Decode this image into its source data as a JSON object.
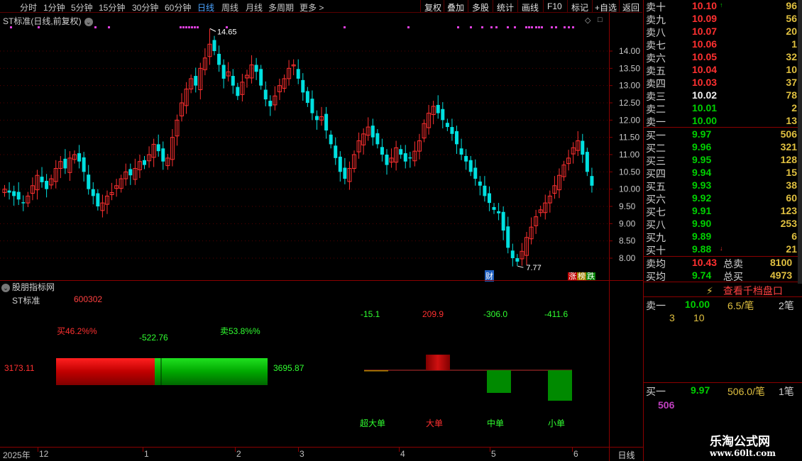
{
  "toolbar": {
    "periods": [
      "分时",
      "1分钟",
      "5分钟",
      "15分钟",
      "30分钟",
      "60分钟",
      "日线",
      "周线",
      "月线",
      "多周期",
      "更多"
    ],
    "active_period": "日线",
    "more_arrow": ">",
    "actions": [
      "复权",
      "叠加",
      "多股",
      "统计",
      "画线",
      "F10",
      "标记",
      "+自选",
      "返回"
    ]
  },
  "chart": {
    "title": "ST标准(日线,前复权)",
    "high_label": "14.65",
    "low_label": "7.77",
    "y_ticks": [
      "14.00",
      "13.50",
      "13.00",
      "12.50",
      "12.00",
      "11.50",
      "11.00",
      "10.50",
      "10.00",
      "9.50",
      "9.00",
      "8.50",
      "8.00"
    ],
    "badge_cai": "财",
    "badge_zhang": "涨",
    "badge_ta": "榜",
    "badge_die": "跌"
  },
  "chart_data": {
    "type": "candlestick",
    "title": "ST标准(日线,前复权)",
    "ylim": [
      7.7,
      14.9
    ],
    "y_ticks": [
      8.0,
      8.5,
      9.0,
      9.5,
      10.0,
      10.5,
      11.0,
      11.5,
      12.0,
      12.5,
      13.0,
      13.5,
      14.0
    ],
    "high": 14.65,
    "low": 7.77,
    "x_ticks": [
      "2025年",
      "12",
      "1",
      "2",
      "3",
      "4",
      "5",
      "6"
    ],
    "closes": [
      10.0,
      9.9,
      9.8,
      9.7,
      9.6,
      9.8,
      10.1,
      10.4,
      10.2,
      10.0,
      10.3,
      10.6,
      10.8,
      10.6,
      10.9,
      11.0,
      10.8,
      10.5,
      10.0,
      9.8,
      9.5,
      9.6,
      9.8,
      9.9,
      10.1,
      10.3,
      10.5,
      10.4,
      10.6,
      10.8,
      10.7,
      11.0,
      11.3,
      11.1,
      10.8,
      10.9,
      11.5,
      12.0,
      12.5,
      12.9,
      13.2,
      13.0,
      13.5,
      13.8,
      14.2,
      14.0,
      13.6,
      13.2,
      13.4,
      13.0,
      12.7,
      13.1,
      13.3,
      13.6,
      13.4,
      13.0,
      12.6,
      12.4,
      12.7,
      13.0,
      13.2,
      13.5,
      13.6,
      13.2,
      12.8,
      12.5,
      12.2,
      12.0,
      12.1,
      11.7,
      11.3,
      10.9,
      10.5,
      10.3,
      10.6,
      11.0,
      11.4,
      11.6,
      11.8,
      11.5,
      11.3,
      11.0,
      10.7,
      10.9,
      11.2,
      11.0,
      10.8,
      10.9,
      11.1,
      11.4,
      11.9,
      12.2,
      12.4,
      12.2,
      12.0,
      11.8,
      11.6,
      11.3,
      11.0,
      10.8,
      10.5,
      10.3,
      10.1,
      9.8,
      9.6,
      9.4,
      9.3,
      8.8,
      8.3,
      8.0,
      7.9,
      8.2,
      8.6,
      8.9,
      9.2,
      9.4,
      9.6,
      9.8,
      10.1,
      10.4,
      10.7,
      10.9,
      11.2,
      11.4,
      11.0,
      10.5,
      10.1
    ]
  },
  "indicator": {
    "title": "股朋指标网",
    "stock_name": "ST标准",
    "stock_code": "600302",
    "buy_pct": "买46.2%%",
    "sell_pct": "卖53.8%%",
    "net": "-522.76",
    "left_val": "3173.11",
    "right_val": "3695.87",
    "flows": [
      {
        "label": "超大单",
        "value": "-15.1",
        "num": -15.1
      },
      {
        "label": "大单",
        "value": "209.9",
        "num": 209.9
      },
      {
        "label": "中单",
        "value": "-306.0",
        "num": -306.0
      },
      {
        "label": "小单",
        "value": "-411.6",
        "num": -411.6
      }
    ]
  },
  "dates": [
    "2025年",
    "12",
    "1",
    "2",
    "3",
    "4",
    "5",
    "6"
  ],
  "period_label": "日线",
  "book": {
    "asks": [
      {
        "label": "卖十",
        "price": "10.10",
        "vol": "96",
        "cls": "up",
        "arrow": "↑"
      },
      {
        "label": "卖九",
        "price": "10.09",
        "vol": "56",
        "cls": "up"
      },
      {
        "label": "卖八",
        "price": "10.07",
        "vol": "20",
        "cls": "up"
      },
      {
        "label": "卖七",
        "price": "10.06",
        "vol": "1",
        "cls": "up"
      },
      {
        "label": "卖六",
        "price": "10.05",
        "vol": "32",
        "cls": "up"
      },
      {
        "label": "卖五",
        "price": "10.04",
        "vol": "10",
        "cls": "up"
      },
      {
        "label": "卖四",
        "price": "10.03",
        "vol": "37",
        "cls": "up"
      },
      {
        "label": "卖三",
        "price": "10.02",
        "vol": "78",
        "cls": "flat"
      },
      {
        "label": "卖二",
        "price": "10.01",
        "vol": "2",
        "cls": "dn"
      },
      {
        "label": "卖一",
        "price": "10.00",
        "vol": "13",
        "cls": "dn"
      }
    ],
    "bids": [
      {
        "label": "买一",
        "price": "9.97",
        "vol": "506",
        "cls": "dn"
      },
      {
        "label": "买二",
        "price": "9.96",
        "vol": "321",
        "cls": "dn"
      },
      {
        "label": "买三",
        "price": "9.95",
        "vol": "128",
        "cls": "dn"
      },
      {
        "label": "买四",
        "price": "9.94",
        "vol": "15",
        "cls": "dn"
      },
      {
        "label": "买五",
        "price": "9.93",
        "vol": "38",
        "cls": "dn"
      },
      {
        "label": "买六",
        "price": "9.92",
        "vol": "60",
        "cls": "dn"
      },
      {
        "label": "买七",
        "price": "9.91",
        "vol": "123",
        "cls": "dn"
      },
      {
        "label": "买八",
        "price": "9.90",
        "vol": "253",
        "cls": "dn"
      },
      {
        "label": "买九",
        "price": "9.89",
        "vol": "6",
        "cls": "dn"
      },
      {
        "label": "买十",
        "price": "9.88",
        "vol": "21",
        "cls": "dn",
        "arrow": "↓"
      }
    ],
    "avg_sell_label": "卖均",
    "avg_sell": "10.43",
    "total_sell_label": "总卖",
    "total_sell": "8100",
    "avg_buy_label": "买均",
    "avg_buy": "9.74",
    "total_buy_label": "总买",
    "total_buy": "4973",
    "qiandang_label": "查看千档盘口",
    "sell1_label": "卖一",
    "sell1_price": "10.00",
    "sell1_vol": "6.5/笔",
    "sell1_count": "2笔",
    "sell1_q1": "3",
    "sell1_q2": "10",
    "buy1_label": "买一",
    "buy1_price": "9.97",
    "buy1_vol": "506.0/笔",
    "buy1_count": "1笔",
    "buy1_q": "506"
  },
  "watermark": {
    "line1": "乐淘公式网",
    "line2": "www.60lt.com"
  },
  "colors": {
    "up": "#ff3030",
    "down": "#00e0e0",
    "border": "#8b0000",
    "buy_bar": "#e00000",
    "sell_bar": "#00b000"
  }
}
